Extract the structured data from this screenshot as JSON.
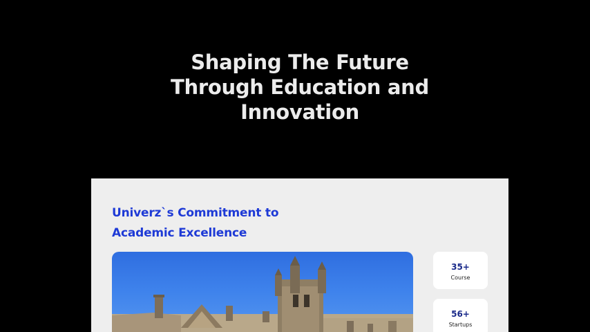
{
  "hero": {
    "title": "Shaping The Future Through Education and Innovation"
  },
  "commitment": {
    "title": "Univerz`s Commitment to Academic Excellence"
  },
  "stats": [
    {
      "value": "35+",
      "label": "Course"
    },
    {
      "value": "56+",
      "label": "Startups"
    }
  ],
  "images": {
    "campus_photo": "university-building-photo"
  },
  "colors": {
    "hero_background": "#000000",
    "hero_text": "#ececec",
    "section_background": "#eeeeee",
    "accent_blue": "#1e3ad6",
    "stat_value": "#1a2a8a",
    "card_background": "#ffffff"
  }
}
